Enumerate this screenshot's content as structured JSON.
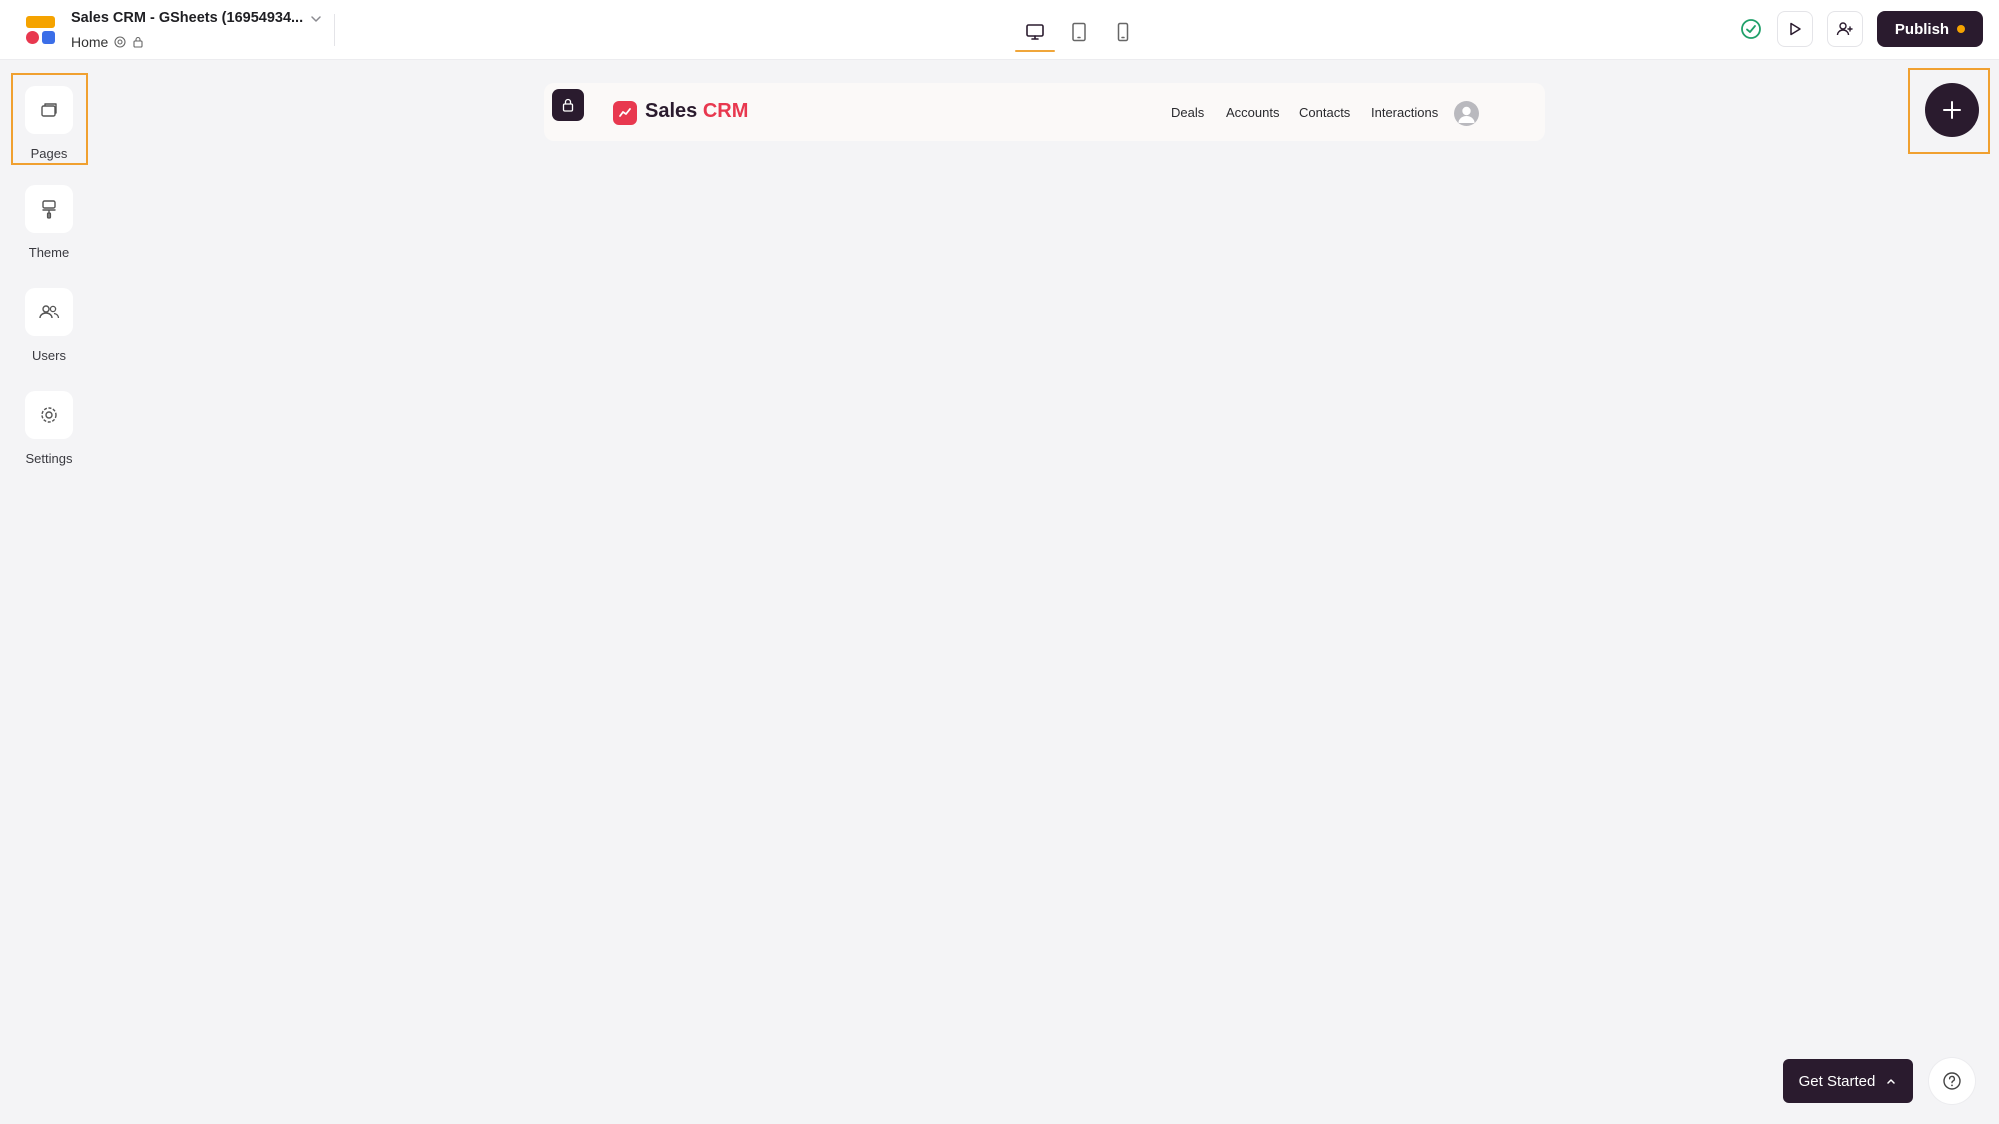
{
  "app": {
    "title": "Sales CRM - GSheets (16954934...",
    "breadcrumb": "Home",
    "icons": [
      "app-logo",
      "chevron-down-icon",
      "gear-icon",
      "lock-icon"
    ]
  },
  "device_switcher": {
    "active": "desktop",
    "items": [
      "desktop-icon",
      "tablet-icon",
      "mobile-icon"
    ]
  },
  "toolbar": {
    "status_icon": "check-circle-icon",
    "preview_icon": "play-icon",
    "invite_icon": "user-plus-icon",
    "publish_label": "Publish"
  },
  "sidebar": {
    "items": [
      {
        "label": "Pages",
        "icon": "pages-icon",
        "highlighted": true
      },
      {
        "label": "Theme",
        "icon": "paint-roller-icon",
        "highlighted": false
      },
      {
        "label": "Users",
        "icon": "users-icon",
        "highlighted": false
      },
      {
        "label": "Settings",
        "icon": "gear-icon",
        "highlighted": false
      }
    ]
  },
  "preview": {
    "brand_primary": "Sales",
    "brand_accent": "CRM",
    "nav": [
      "Deals",
      "Accounts",
      "Contacts",
      "Interactions"
    ]
  },
  "add_button": {
    "icon": "plus-icon",
    "highlighted": true
  },
  "footer": {
    "get_started_label": "Get Started",
    "help_icon": "question-circle-icon"
  },
  "colors": {
    "dark": "#2a1b2e",
    "accent_red": "#e8384f",
    "highlight_orange": "#f0a030",
    "success_green": "#20a06a",
    "warning_dot": "#f5a300",
    "canvas_bg": "#f4f4f6"
  }
}
